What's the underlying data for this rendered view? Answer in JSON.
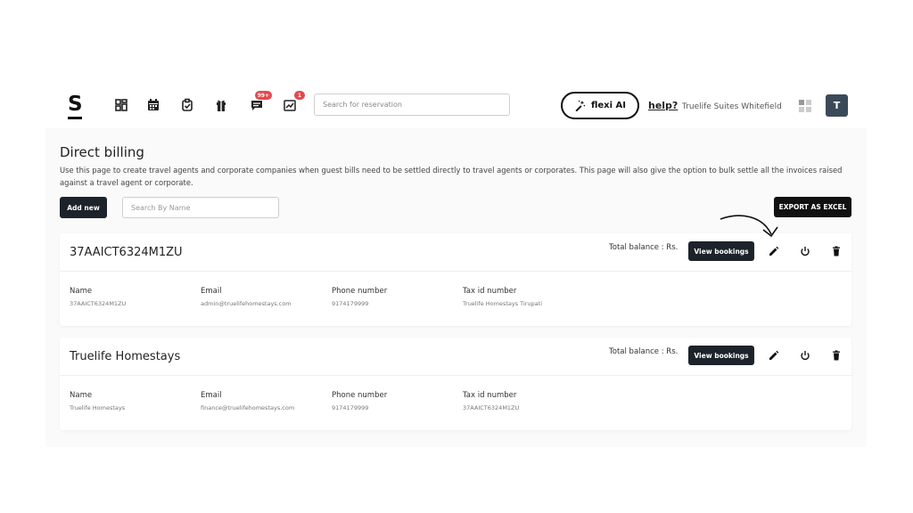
{
  "header": {
    "logo": "S",
    "nav_icons": [
      "dashboard-icon",
      "calendar-icon",
      "clipboard-check-icon",
      "gift-icon",
      "chat-icon",
      "reviews-icon"
    ],
    "chat_badge": "99+",
    "reviews_badge": "1",
    "search_placeholder": "Search for reservation",
    "flexi_label": "flexi AI",
    "help_label": "help?",
    "hotel_name": "Truelife Suites Whitefield",
    "avatar_initial": "T"
  },
  "page": {
    "title": "Direct billing",
    "description": "Use this page to create travel agents and corporate companies when guest bills need to be settled directly to travel agents or corporates. This page will also give the option to bulk settle all the invoices raised against a travel agent or corporate."
  },
  "toolbar": {
    "add_label": "Add new",
    "search_placeholder": "Search By Name",
    "export_label": "EXPORT AS EXCEL"
  },
  "field_labels": {
    "name": "Name",
    "email": "Email",
    "phone": "Phone number",
    "tax": "Tax id number"
  },
  "cards": [
    {
      "title": "37AAICT6324M1ZU",
      "balance": "Total balance : Rs.",
      "view_label": "View bookings",
      "name": "37AAICT6324M1ZU",
      "email": "admin@truelifehomestays.com",
      "phone": "9174179999",
      "tax": "Truelife Homestays Tirupati"
    },
    {
      "title": "Truelife Homestays",
      "balance": "Total balance : Rs.",
      "view_label": "View bookings",
      "name": "Truelife Homestays",
      "email": "finance@truelifehomestays.com",
      "phone": "9174179999",
      "tax": "37AAICT6324M1ZU"
    }
  ],
  "colors": {
    "primary_button": "#1d232a",
    "badge": "#e5484d",
    "avatar": "#3a4a59"
  }
}
